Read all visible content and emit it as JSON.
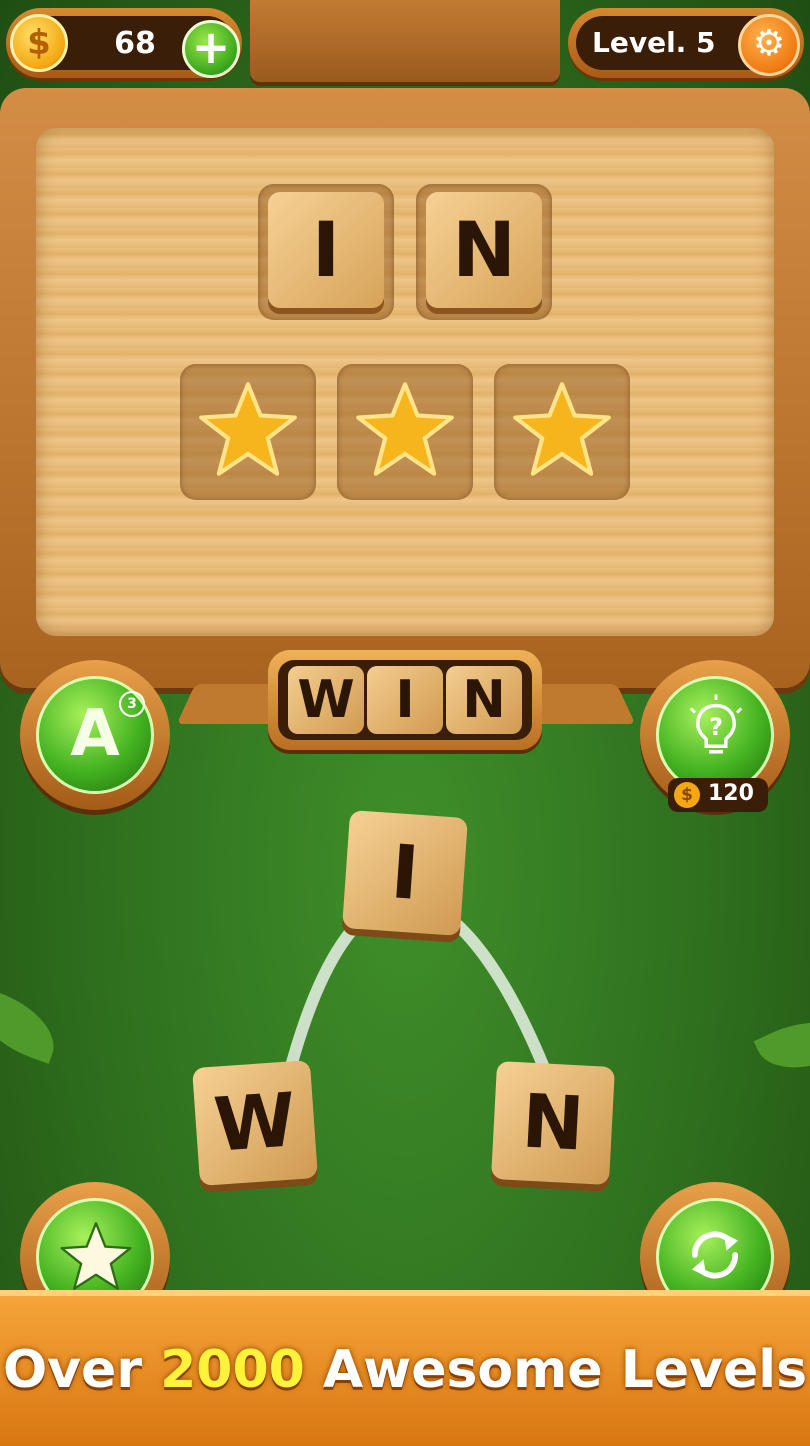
{
  "hud": {
    "coins": "68",
    "coin_symbol": "$",
    "add_coins_symbol": "+",
    "level_label": "Level. 5",
    "settings_icon": "gear-icon"
  },
  "board": {
    "found_word_tiles": [
      "I",
      "N"
    ],
    "star_slots": 3
  },
  "current_word": [
    "W",
    "I",
    "N"
  ],
  "side_buttons": {
    "letter_hint_letter": "A",
    "letter_hint_count": "3",
    "hint_cost": "120",
    "hint_icon": "lightbulb-question-icon",
    "favorites_icon": "star-icon",
    "shuffle_icon": "refresh-icon"
  },
  "letter_wheel": [
    "I",
    "W",
    "N"
  ],
  "banner": {
    "part1": "Over ",
    "highlight": "2000",
    "part2": " Awesome Levels"
  },
  "colors": {
    "felt_green": "#3f8f2a",
    "wood": "#e3b26a",
    "button_green": "#45b321",
    "ribbon_orange": "#f5a53a",
    "highlight_yellow": "#fff23b"
  }
}
